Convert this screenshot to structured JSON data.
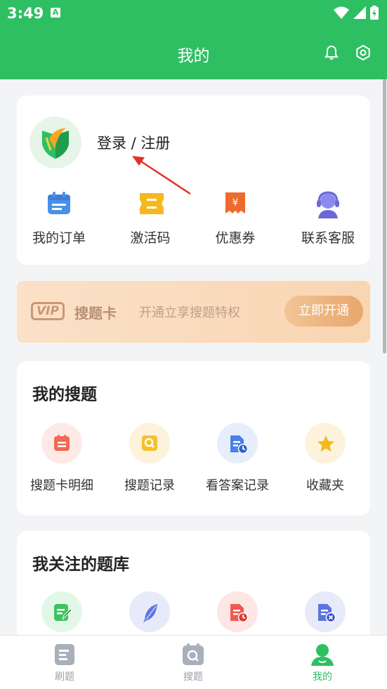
{
  "status_bar": {
    "time": "3:49",
    "notification_badge": "A"
  },
  "app_bar": {
    "title": "我的",
    "icons": [
      "bell-icon",
      "gear-icon"
    ]
  },
  "profile": {
    "login_label": "登录 / 注册"
  },
  "quick_actions": [
    {
      "label": "我的订单",
      "icon": "calendar-icon",
      "color": "#4a90e8"
    },
    {
      "label": "激活码",
      "icon": "ticket-icon",
      "color": "#f5b81f"
    },
    {
      "label": "优惠券",
      "icon": "coupon-icon",
      "color": "#ef6a2e"
    },
    {
      "label": "联系客服",
      "icon": "headset-icon",
      "color": "#7b79e8"
    }
  ],
  "vip_banner": {
    "badge": "VIP",
    "title": "搜题卡",
    "subtitle": "开通立享搜题特权",
    "button": "立即开通"
  },
  "my_search": {
    "title": "我的搜题",
    "items": [
      {
        "label": "搜题卡明细",
        "icon": "list-icon",
        "color": "#f06a55",
        "bg": "#fdeae6"
      },
      {
        "label": "搜题记录",
        "icon": "search-record-icon",
        "color": "#f5c02f",
        "bg": "#fdf3dc"
      },
      {
        "label": "看答案记录",
        "icon": "document-clock-icon",
        "color": "#4a7fe8",
        "bg": "#e6eefc"
      },
      {
        "label": "收藏夹",
        "icon": "star-icon",
        "color": "#f5b81f",
        "bg": "#fdf3dc"
      }
    ]
  },
  "followed_banks": {
    "title": "我关注的题库",
    "items": [
      {
        "icon": "edit-note-icon",
        "color": "#3cc35f",
        "bg": "#e3f7e6"
      },
      {
        "icon": "feather-icon",
        "color": "#5a74e0",
        "bg": "#e6eaf9"
      },
      {
        "icon": "doc-clock-icon",
        "color": "#ef5a4f",
        "bg": "#fde6e4"
      },
      {
        "icon": "doc-x-icon",
        "color": "#5a74e0",
        "bg": "#e6eaf9"
      }
    ]
  },
  "bottom_nav": [
    {
      "label": "刷题",
      "icon": "practice-icon",
      "active": false
    },
    {
      "label": "搜题",
      "icon": "search-tab-icon",
      "active": false
    },
    {
      "label": "我的",
      "icon": "profile-icon",
      "active": true
    }
  ],
  "colors": {
    "brand": "#2fbf63",
    "background": "#f3f4f6"
  }
}
